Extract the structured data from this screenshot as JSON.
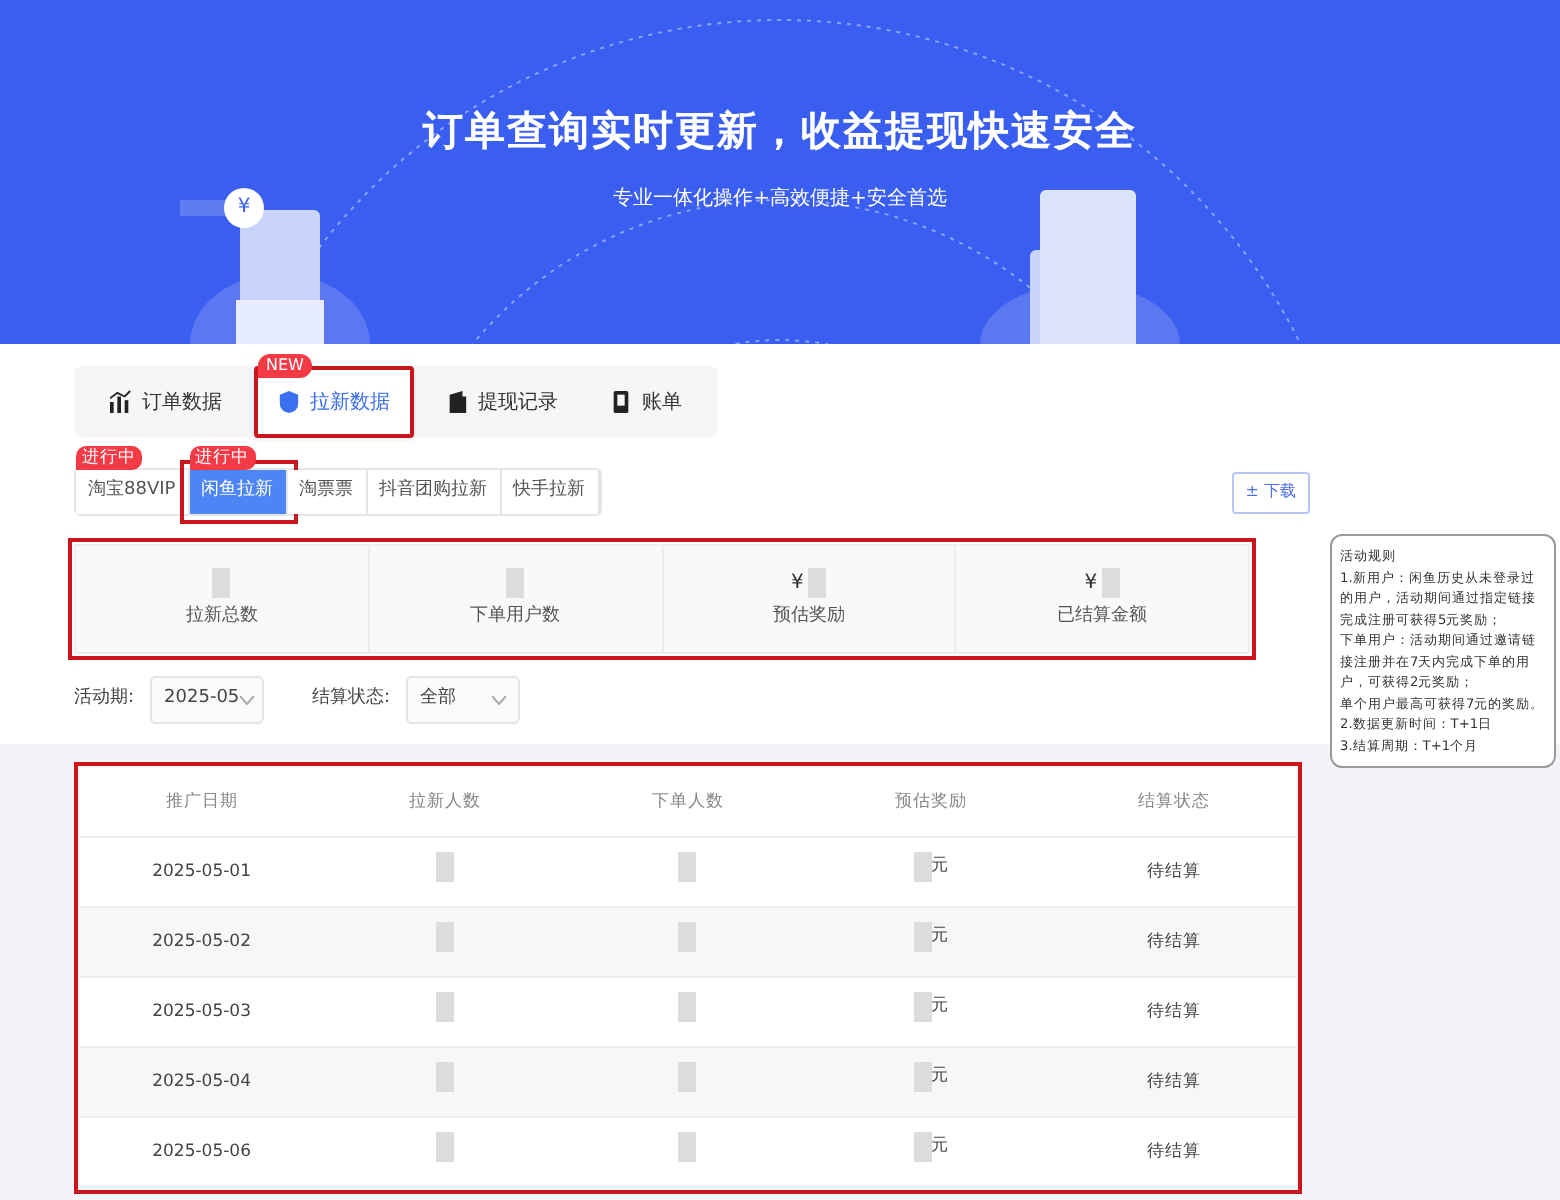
{
  "banner": {
    "title": "订单查询实时更新，收益提现快速安全",
    "subtitle": "专业一体化操作+高效便捷+安全首选",
    "currency_mark": "¥"
  },
  "tabs": [
    {
      "label": "订单数据",
      "selected": false,
      "highlighted": false
    },
    {
      "label": "拉新数据",
      "selected": true,
      "highlighted": true,
      "badge": "NEW"
    },
    {
      "label": "提现记录",
      "selected": false,
      "highlighted": false
    },
    {
      "label": "账单",
      "selected": false,
      "highlighted": false
    }
  ],
  "sub_tabs": [
    {
      "label": "淘宝88VIP",
      "selected": false,
      "highlighted": false,
      "badge": "进行中"
    },
    {
      "label": "闲鱼拉新",
      "selected": true,
      "highlighted": true,
      "badge": "进行中"
    },
    {
      "label": "淘票票",
      "selected": false,
      "highlighted": false
    },
    {
      "label": "抖音团购拉新",
      "selected": false,
      "highlighted": false
    },
    {
      "label": "快手拉新",
      "selected": false,
      "highlighted": false
    }
  ],
  "download_button": {
    "icon": "±",
    "label": "下载"
  },
  "stats": {
    "highlighted": true,
    "items": [
      {
        "label": "拉新总数"
      },
      {
        "label": "下单用户数"
      },
      {
        "label": "预估奖励",
        "prefix": "¥"
      },
      {
        "label": "已结算金额",
        "prefix": "¥"
      }
    ]
  },
  "filters": [
    {
      "label": "活动期:",
      "value": "2025-05"
    },
    {
      "label": "结算状态:",
      "value": "全部"
    }
  ],
  "table": {
    "highlighted": true,
    "columns": [
      "推广日期",
      "拉新人数",
      "下单人数",
      "预估奖励",
      "结算状态"
    ],
    "rows": [
      {
        "date": "2025-05-01",
        "reward_unit": "元",
        "status": "待结算"
      },
      {
        "date": "2025-05-02",
        "reward_unit": "元",
        "status": "待结算"
      },
      {
        "date": "2025-05-03",
        "reward_unit": "元",
        "status": "待结算"
      },
      {
        "date": "2025-05-04",
        "reward_unit": "元",
        "status": "待结算"
      },
      {
        "date": "2025-05-06",
        "reward_unit": "元",
        "status": "待结算"
      }
    ]
  },
  "rules": {
    "title": "活动规则",
    "lines": [
      "1.新用户：闲鱼历史从未登录过的用户，活动期间通过指定链接完成注册可获得5元奖励；",
      "下单用户：活动期间通过邀请链接注册并在7天内完成下单的用户，可获得2元奖励；",
      "单个用户最高可获得7元的奖励。",
      "2.数据更新时间：T+1日",
      "3.结算周期：T+1个月"
    ]
  }
}
